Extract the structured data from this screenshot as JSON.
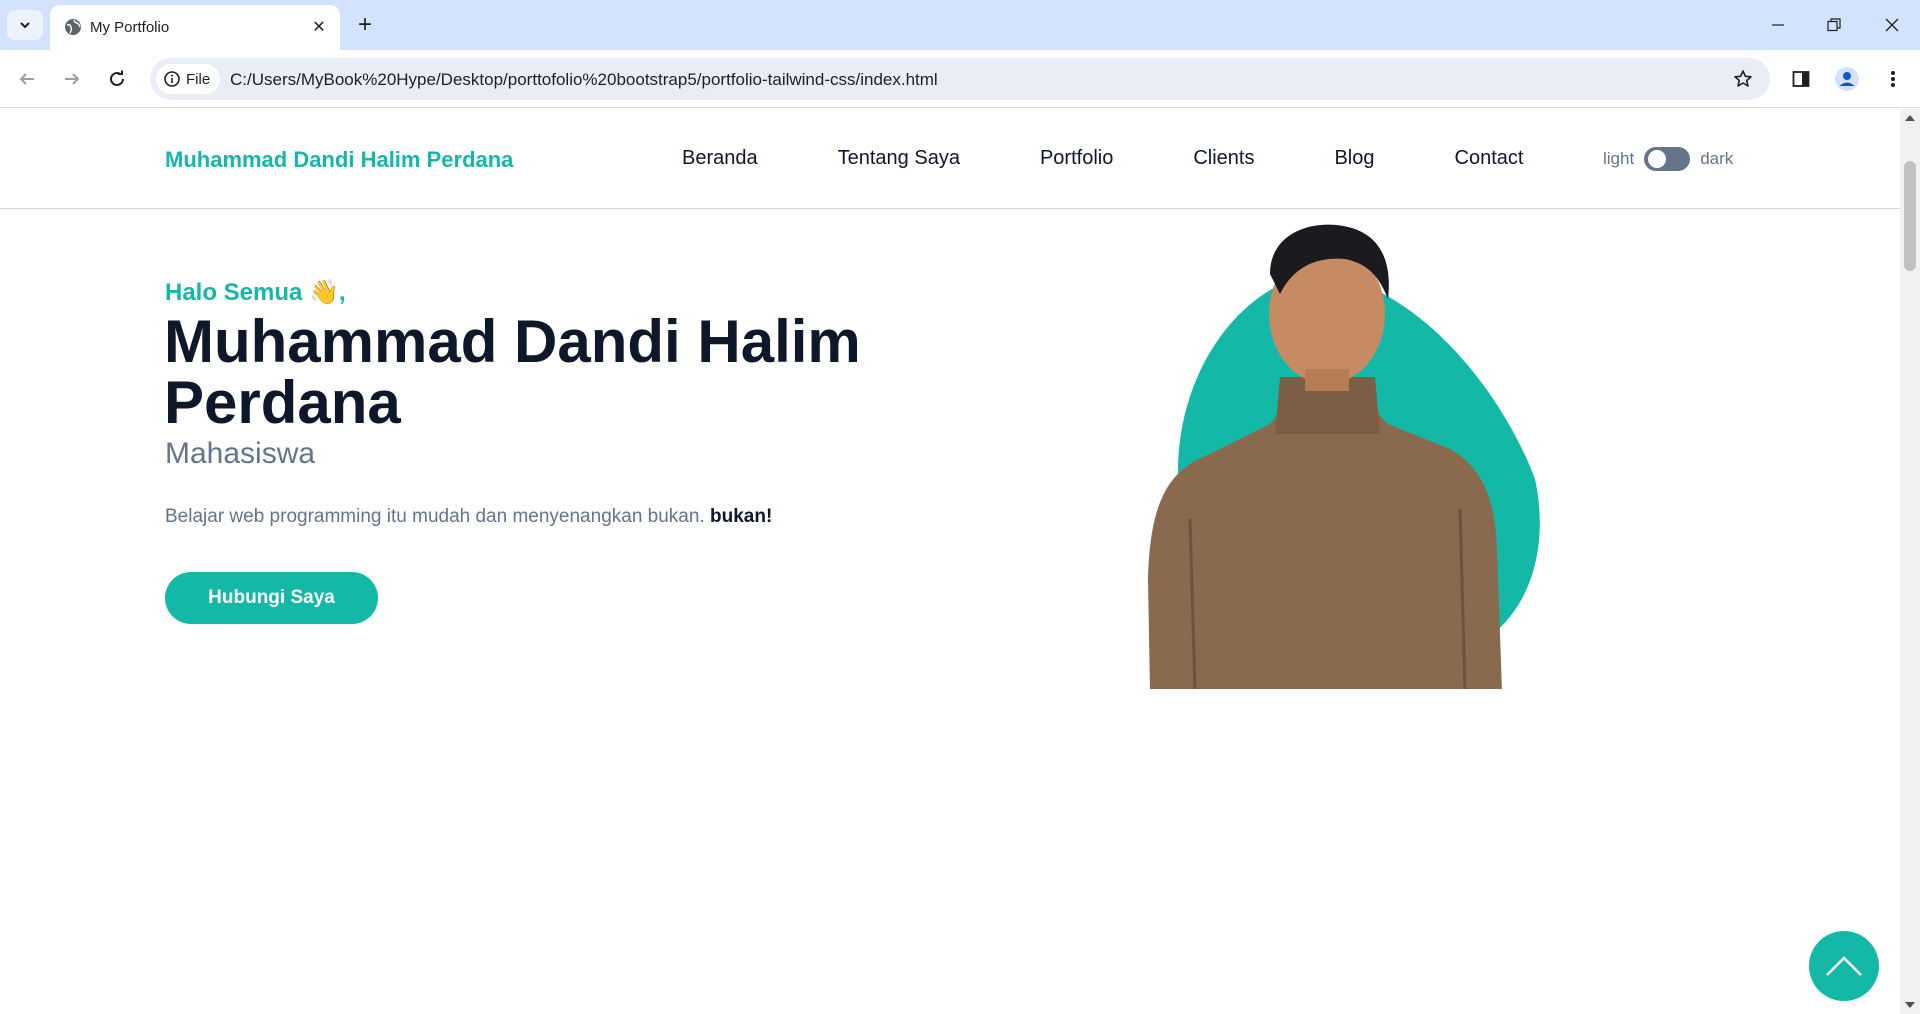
{
  "browser": {
    "tab_title": "My Portfolio",
    "url_chip": "File",
    "url": "C:/Users/MyBook%20Hype/Desktop/porttofolio%20bootstrap5/portfolio-tailwind-css/index.html"
  },
  "header": {
    "brand": "Muhammad Dandi Halim Perdana",
    "nav": [
      "Beranda",
      "Tentang Saya",
      "Portfolio",
      "Clients",
      "Blog",
      "Contact"
    ],
    "theme_light": "light",
    "theme_dark": "dark"
  },
  "hero": {
    "greeting": "Halo Semua 👋,",
    "name": "Muhammad Dandi Halim Perdana",
    "role": "Mahasiswa",
    "description": "Belajar web programming itu mudah dan menyenangkan bukan.",
    "description_emphasis": "bukan!",
    "cta": "Hubungi Saya"
  },
  "colors": {
    "accent": "#14b8a6",
    "heading": "#0f172a",
    "muted": "#64748b",
    "chrome_tabbar": "#d3e3fd"
  },
  "icons": {
    "tab_favicon": "globe-icon",
    "back_to_top": "chevron-up-icon"
  }
}
